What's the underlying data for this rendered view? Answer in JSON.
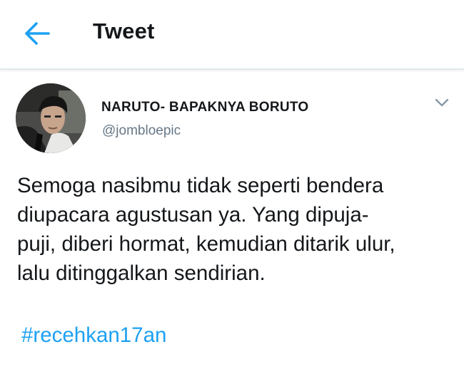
{
  "header": {
    "title": "Tweet",
    "back_icon": "arrow-left-icon"
  },
  "tweet": {
    "author": {
      "display_name": "NARUTO- BAPAKNYA BORUTO",
      "handle": "@jombloepic"
    },
    "caret_icon": "chevron-down-icon",
    "text_lines": [
      "Semoga nasibmu tidak seperti bendera",
      "diupacara agustusan ya. Yang dipuja-",
      "puji, diberi hormat, kemudian ditarik ulur,",
      "lalu ditinggalkan sendirian."
    ],
    "hashtag": "#recehkan17an"
  },
  "colors": {
    "accent": "#1da1f2",
    "text": "#14171a",
    "secondary_text": "#657786",
    "divider": "#e1e8ed"
  }
}
